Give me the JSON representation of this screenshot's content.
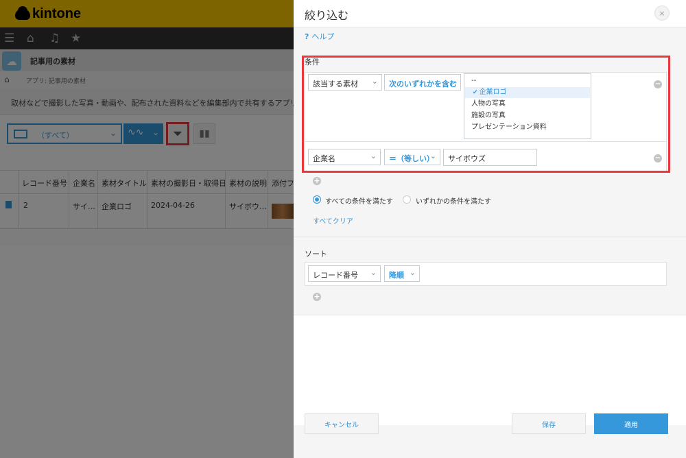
{
  "app": {
    "logo_text": "kintone",
    "app_name": "記事用の素材",
    "breadcrumb": "アプリ: 記事用の素材",
    "description": "取材などで撮影した写真・動画や、配布された資料などを編集部内で共有するアプリで",
    "view_name": "（すべて）"
  },
  "table": {
    "columns": [
      "レコード番号",
      "企業名",
      "素材タイトル",
      "素材の撮影日・取得日",
      "素材の説明",
      "添付フ"
    ],
    "trailing_header": "ファ",
    "row": {
      "record_no": "2",
      "company": "サイ…",
      "title": "企業ロゴ",
      "date": "2024-04-26",
      "description": "サイボウ…"
    }
  },
  "dialog": {
    "title": "絞り込む",
    "close_glyph": "×",
    "help_label": "ヘルプ",
    "condition_title": "条件",
    "condition1": {
      "field": "該当する素材",
      "operator": "次のいずれかを含む",
      "options": [
        "--",
        "企業ロゴ",
        "人物の写真",
        "施設の写真",
        "プレゼンテーション資料"
      ],
      "selected_option": "企業ロゴ"
    },
    "condition2": {
      "field": "企業名",
      "operator": "＝（等しい）",
      "value": "サイボウズ"
    },
    "match_all_label": "すべての条件を満たす",
    "match_any_label": "いずれかの条件を満たす",
    "clear_all_label": "すべてクリア",
    "sort_title": "ソート",
    "sort_field": "レコード番号",
    "sort_order": "降順",
    "cancel_label": "キャンセル",
    "save_label": "保存",
    "apply_label": "適用"
  },
  "colors": {
    "accent": "#3498db",
    "highlight": "#e8383d",
    "brand": "#fcc800"
  }
}
